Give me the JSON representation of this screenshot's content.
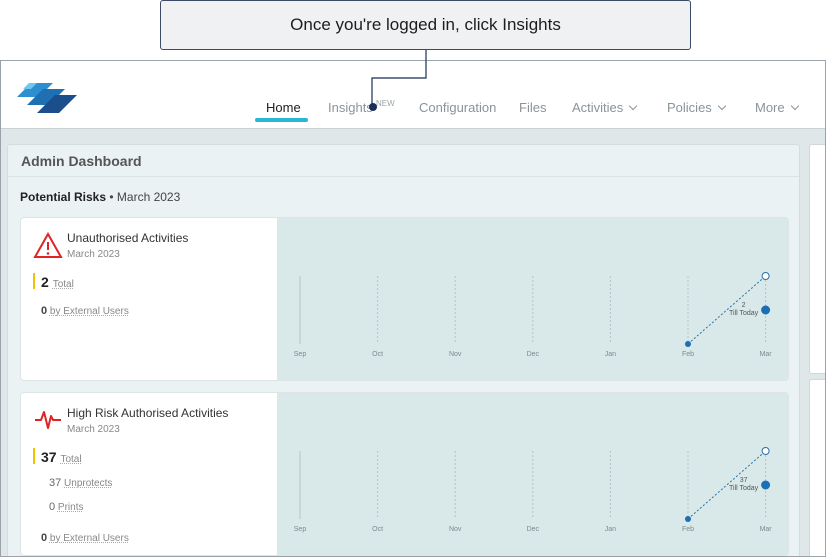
{
  "callout": {
    "text": "Once you're logged in, click Insights"
  },
  "nav": {
    "items": [
      {
        "label": "Home",
        "active": true
      },
      {
        "label": "Insights",
        "badge": "NEW"
      },
      {
        "label": "Configuration"
      },
      {
        "label": "Files"
      },
      {
        "label": "Activities",
        "dropdown": true
      },
      {
        "label": "Policies",
        "dropdown": true
      },
      {
        "label": "More",
        "dropdown": true
      }
    ]
  },
  "dashboard": {
    "title": "Admin Dashboard",
    "section_title": "Potential Risks",
    "section_sub": "• March 2023"
  },
  "cards": [
    {
      "title": "Unauthorised Activities",
      "subtitle": "March 2023",
      "icon": "warning-triangle-icon",
      "total_value": "2",
      "total_label": "Total",
      "stats": [
        {
          "value": "0",
          "label": "by External Users"
        }
      ],
      "chart_data": {
        "type": "line",
        "categories": [
          "Sep",
          "Oct",
          "Nov",
          "Dec",
          "Jan",
          "Feb",
          "Mar"
        ],
        "series": [
          {
            "values": [
              null,
              null,
              null,
              null,
              null,
              0,
              2
            ]
          }
        ],
        "annotation": {
          "value": "2",
          "label": "Till Today"
        }
      }
    },
    {
      "title": "High Risk Authorised Activities",
      "subtitle": "March 2023",
      "icon": "heartbeat-icon",
      "total_value": "37",
      "total_label": "Total",
      "stats": [
        {
          "value": "37",
          "label": "Unprotects"
        },
        {
          "value": "0",
          "label": "Prints"
        },
        {
          "value": "0",
          "label": "by External Users"
        }
      ],
      "chart_data": {
        "type": "line",
        "categories": [
          "Sep",
          "Oct",
          "Nov",
          "Dec",
          "Jan",
          "Feb",
          "Mar"
        ],
        "series": [
          {
            "values": [
              null,
              null,
              null,
              null,
              null,
              0,
              37
            ]
          }
        ],
        "annotation": {
          "value": "37",
          "label": "Till Today"
        }
      }
    }
  ],
  "colors": {
    "accent": "#29b6d6",
    "chart_point": "#1a6fb5",
    "chart_bg": "#d9e8e9",
    "alert_red": "#e02424",
    "total_bar": "#f2c200"
  }
}
